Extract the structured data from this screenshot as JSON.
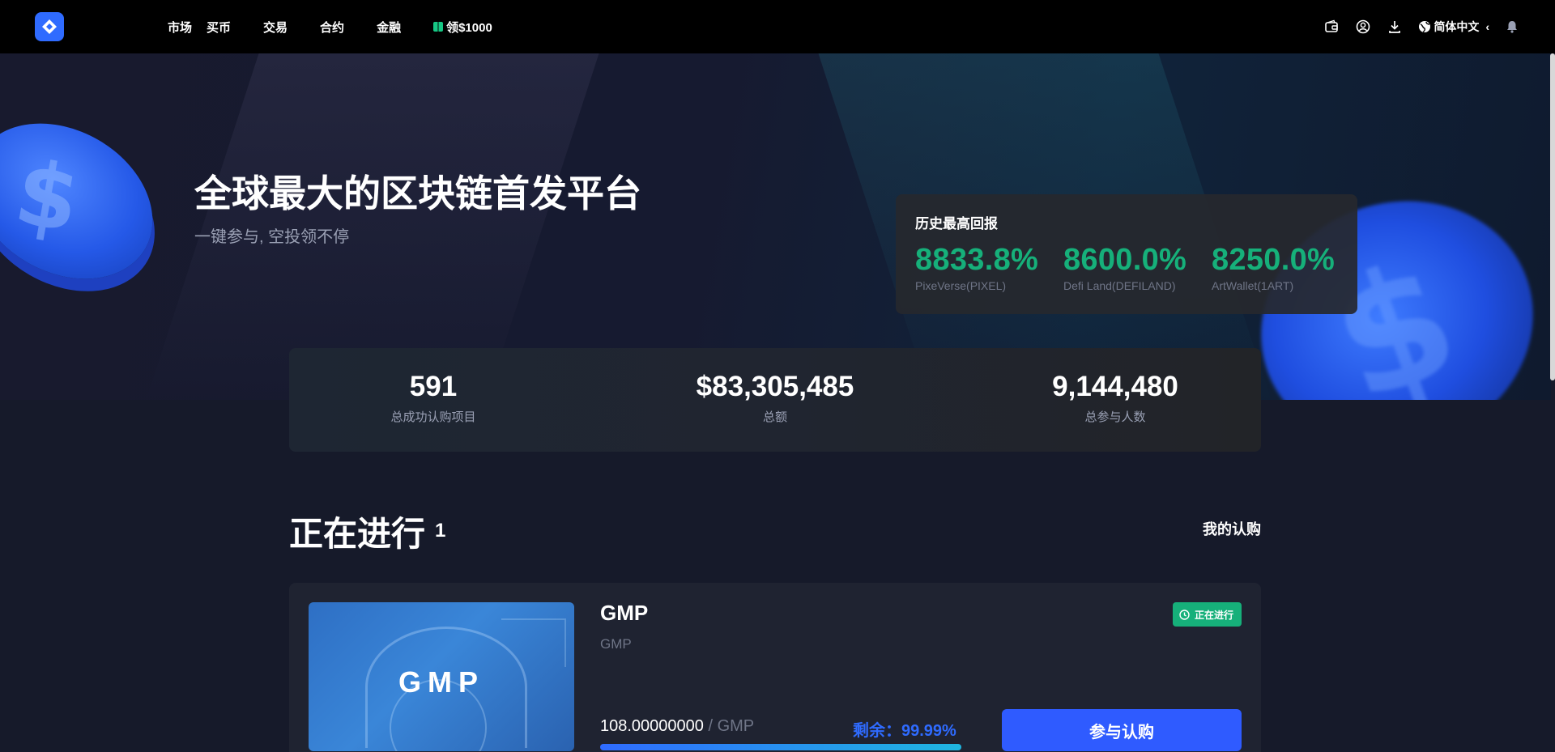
{
  "nav": {
    "links": [
      "市场",
      "买币",
      "交易",
      "合约",
      "金融"
    ],
    "promo": "领$1000",
    "language": "简体中文"
  },
  "hero": {
    "title": "全球最大的区块链首发平台",
    "subtitle": "一键参与, 空投领不停"
  },
  "returns": {
    "title": "历史最高回报",
    "items": [
      {
        "pct": "8833.8%",
        "name": "PixeVerse(PIXEL)"
      },
      {
        "pct": "8600.0%",
        "name": "Defi Land(DEFILAND)"
      },
      {
        "pct": "8250.0%",
        "name": "ArtWallet(1ART)"
      }
    ]
  },
  "stats": [
    {
      "value": "591",
      "label": "总成功认购项目"
    },
    {
      "value": "$83,305,485",
      "label": "总额"
    },
    {
      "value": "9,144,480",
      "label": "总参与人数"
    }
  ],
  "ongoing": {
    "title": "正在进行",
    "count": "1",
    "my_subscriptions": "我的认购"
  },
  "project": {
    "image_text": "GMP",
    "name": "GMP",
    "symbol": "GMP",
    "status": "正在进行",
    "amount": "108.00000000",
    "amount_unit": " / GMP",
    "remaining": "剩余：99.99%",
    "progress": 0.9999,
    "button": "参与认购"
  },
  "colors": {
    "accent": "#2f6bff",
    "success": "#16b07a",
    "background": "#161a2a"
  }
}
